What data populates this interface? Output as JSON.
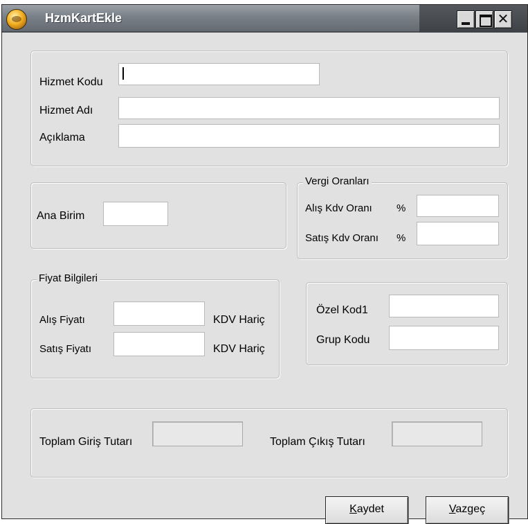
{
  "window": {
    "title": "HzmKartEkle"
  },
  "service": {
    "code_label": "Hizmet Kodu",
    "code_value": "",
    "name_label": "Hizmet Adı",
    "name_value": "",
    "description_label": "Açıklama",
    "description_value": ""
  },
  "unit": {
    "label": "Ana Birim",
    "value": ""
  },
  "tax": {
    "legend": "Vergi Oranları",
    "purchase_label": "Alış Kdv Oranı",
    "purchase_percent": "%",
    "purchase_value": "",
    "sale_label": "Satış Kdv Oranı",
    "sale_percent": "%",
    "sale_value": ""
  },
  "price": {
    "legend": "Fiyat Bilgileri",
    "purchase_label": "Alış Fiyatı",
    "purchase_value": "",
    "purchase_suffix": "KDV Hariç",
    "sale_label": "Satış Fiyatı",
    "sale_value": "",
    "sale_suffix": "KDV Hariç"
  },
  "codes": {
    "special_label": "Özel Kod1",
    "special_value": "",
    "group_label": "Grup Kodu",
    "group_value": ""
  },
  "totals": {
    "in_label": "Toplam Giriş Tutarı",
    "in_value": "",
    "out_label": "Toplam Çıkış Tutarı",
    "out_value": ""
  },
  "buttons": {
    "save_accel": "K",
    "save_rest": "aydet",
    "cancel_accel": "V",
    "cancel_rest": "azgeç"
  }
}
